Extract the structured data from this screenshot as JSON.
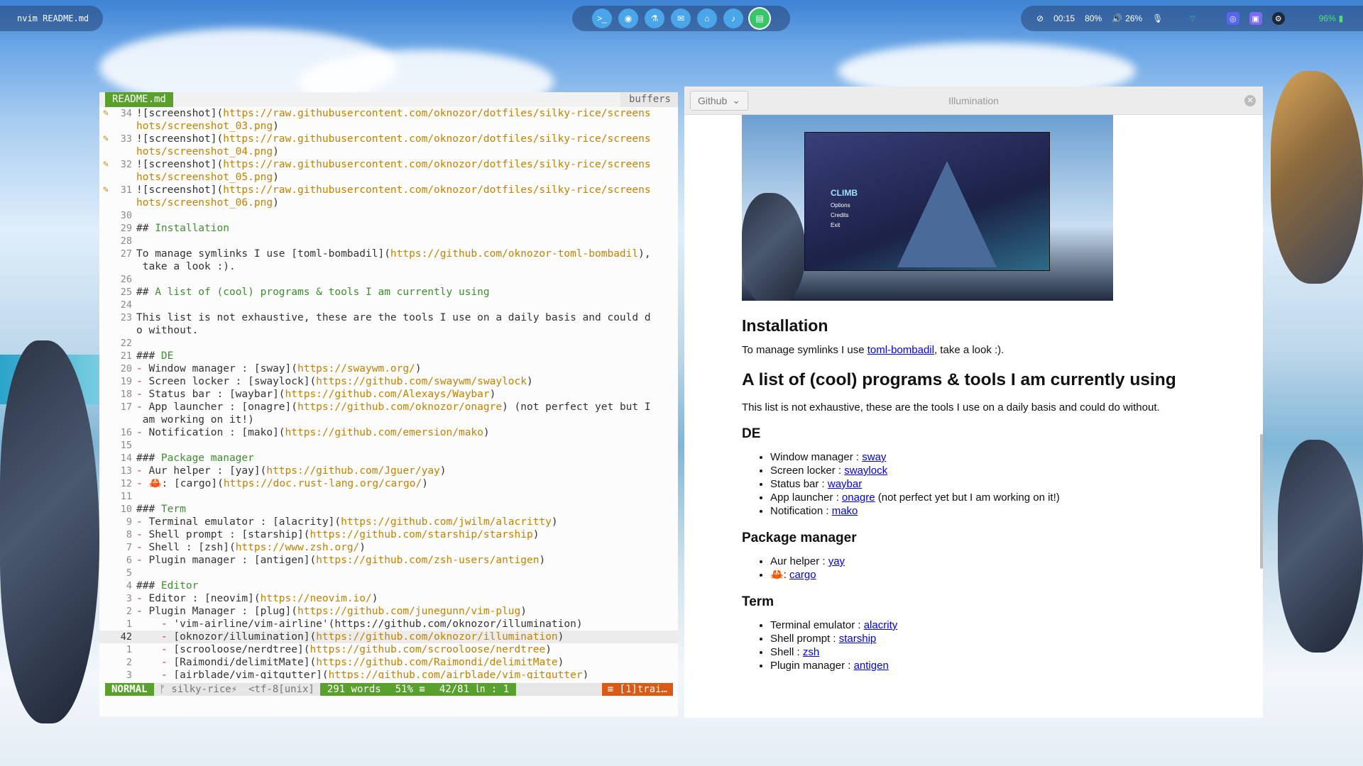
{
  "topbar": {
    "window_title": "nvim README.md",
    "launcher_icons": [
      "terminal-icon",
      "browser-icon",
      "flask-icon",
      "chat-icon",
      "home-icon",
      "music-icon",
      "notes-icon"
    ],
    "status": {
      "time": "00:15",
      "brightness": "80%",
      "volume": "26%",
      "battery": "96%"
    }
  },
  "editor": {
    "tab_active": "README.md",
    "tab_buffers": "buffers",
    "lines": [
      {
        "n": "34",
        "g": "✎",
        "segs": [
          [
            "t",
            "!["
          ],
          [
            "t",
            "screenshot"
          ],
          [
            "t",
            "]("
          ],
          [
            "u",
            "https://raw.githubusercontent.com/oknozor/dotfiles/silky-rice/screens"
          ]
        ]
      },
      {
        "n": "",
        "g": "",
        "segs": [
          [
            "u",
            "hots/screenshot_03.png"
          ],
          [
            "t",
            ")"
          ]
        ]
      },
      {
        "n": "33",
        "g": "✎",
        "segs": [
          [
            "t",
            "![screenshot]("
          ],
          [
            "u",
            "https://raw.githubusercontent.com/oknozor/dotfiles/silky-rice/screens"
          ]
        ]
      },
      {
        "n": "",
        "g": "",
        "segs": [
          [
            "u",
            "hots/screenshot_04.png"
          ],
          [
            "t",
            ")"
          ]
        ]
      },
      {
        "n": "32",
        "g": "✎",
        "segs": [
          [
            "t",
            "![screenshot]("
          ],
          [
            "u",
            "https://raw.githubusercontent.com/oknozor/dotfiles/silky-rice/screens"
          ]
        ]
      },
      {
        "n": "",
        "g": "",
        "segs": [
          [
            "u",
            "hots/screenshot_05.png"
          ],
          [
            "t",
            ")"
          ]
        ]
      },
      {
        "n": "31",
        "g": "✎",
        "segs": [
          [
            "t",
            "![screenshot]("
          ],
          [
            "u",
            "https://raw.githubusercontent.com/oknozor/dotfiles/silky-rice/screens"
          ]
        ]
      },
      {
        "n": "",
        "g": "",
        "segs": [
          [
            "u",
            "hots/screenshot_06.png"
          ],
          [
            "t",
            ")"
          ]
        ]
      },
      {
        "n": "30",
        "g": "",
        "segs": []
      },
      {
        "n": "29",
        "g": "",
        "segs": [
          [
            "t",
            "## "
          ],
          [
            "h",
            "Installation"
          ]
        ]
      },
      {
        "n": "28",
        "g": "",
        "segs": []
      },
      {
        "n": "27",
        "g": "",
        "segs": [
          [
            "t",
            "To manage symlinks I use [toml-bombadil]("
          ],
          [
            "u",
            "https://github.com/oknozor-toml-bombadil"
          ],
          [
            "t",
            "),"
          ]
        ]
      },
      {
        "n": "",
        "g": "",
        "segs": [
          [
            "t",
            " take a look :)."
          ]
        ]
      },
      {
        "n": "26",
        "g": "",
        "segs": []
      },
      {
        "n": "25",
        "g": "",
        "segs": [
          [
            "t",
            "## "
          ],
          [
            "h",
            "A list of (cool) programs & tools I am currently using"
          ]
        ]
      },
      {
        "n": "24",
        "g": "",
        "segs": []
      },
      {
        "n": "23",
        "g": "",
        "segs": [
          [
            "t",
            "This list is not exhaustive, these are the tools I use on a daily basis and could d"
          ]
        ]
      },
      {
        "n": "",
        "g": "",
        "segs": [
          [
            "t",
            "o without."
          ]
        ]
      },
      {
        "n": "22",
        "g": "",
        "segs": []
      },
      {
        "n": "21",
        "g": "",
        "segs": [
          [
            "t",
            "### "
          ],
          [
            "h",
            "DE"
          ]
        ]
      },
      {
        "n": "20",
        "g": "",
        "segs": [
          [
            "b",
            "- "
          ],
          [
            "t",
            "Window manager : [sway]("
          ],
          [
            "u",
            "https://swaywm.org/"
          ],
          [
            "t",
            ")"
          ]
        ]
      },
      {
        "n": "19",
        "g": "",
        "segs": [
          [
            "b",
            "- "
          ],
          [
            "t",
            "Screen locker : [swaylock]("
          ],
          [
            "u",
            "https://github.com/swaywm/swaylock"
          ],
          [
            "t",
            ")"
          ]
        ]
      },
      {
        "n": "18",
        "g": "",
        "segs": [
          [
            "b",
            "- "
          ],
          [
            "t",
            "Status bar : [waybar]("
          ],
          [
            "u",
            "https://github.com/Alexays/Waybar"
          ],
          [
            "t",
            ")"
          ]
        ]
      },
      {
        "n": "17",
        "g": "",
        "segs": [
          [
            "b",
            "- "
          ],
          [
            "t",
            "App launcher : [onagre]("
          ],
          [
            "u",
            "https://github.com/oknozor/onagre"
          ],
          [
            "t",
            ") (not perfect yet but I"
          ]
        ]
      },
      {
        "n": "",
        "g": "",
        "segs": [
          [
            "t",
            " am working on it!)"
          ]
        ]
      },
      {
        "n": "16",
        "g": "",
        "segs": [
          [
            "b",
            "- "
          ],
          [
            "t",
            "Notification : [mako]("
          ],
          [
            "u",
            "https://github.com/emersion/mako"
          ],
          [
            "t",
            ")"
          ]
        ]
      },
      {
        "n": "15",
        "g": "",
        "segs": []
      },
      {
        "n": "14",
        "g": "",
        "segs": [
          [
            "t",
            "### "
          ],
          [
            "h",
            "Package manager"
          ]
        ]
      },
      {
        "n": "13",
        "g": "",
        "segs": [
          [
            "b",
            "- "
          ],
          [
            "t",
            "Aur helper : [yay]("
          ],
          [
            "u",
            "https://github.com/Jguer/yay"
          ],
          [
            "t",
            ")"
          ]
        ]
      },
      {
        "n": "12",
        "g": "",
        "segs": [
          [
            "b",
            "- "
          ],
          [
            "t",
            "🦀: [cargo]("
          ],
          [
            "u",
            "https://doc.rust-lang.org/cargo/"
          ],
          [
            "t",
            ")"
          ]
        ]
      },
      {
        "n": "11",
        "g": "",
        "segs": []
      },
      {
        "n": "10",
        "g": "",
        "segs": [
          [
            "t",
            "### "
          ],
          [
            "h",
            "Term"
          ]
        ]
      },
      {
        "n": "9",
        "g": "",
        "segs": [
          [
            "b",
            "- "
          ],
          [
            "t",
            "Terminal emulator : [alacrity]("
          ],
          [
            "u",
            "https://github.com/jwilm/alacritty"
          ],
          [
            "t",
            ")"
          ]
        ]
      },
      {
        "n": "8",
        "g": "",
        "segs": [
          [
            "b",
            "- "
          ],
          [
            "t",
            "Shell prompt : [starship]("
          ],
          [
            "u",
            "https://github.com/starship/starship"
          ],
          [
            "t",
            ")"
          ]
        ]
      },
      {
        "n": "7",
        "g": "",
        "segs": [
          [
            "b",
            "- "
          ],
          [
            "t",
            "Shell : [zsh]("
          ],
          [
            "u",
            "https://www.zsh.org/"
          ],
          [
            "t",
            ")"
          ]
        ]
      },
      {
        "n": "6",
        "g": "",
        "segs": [
          [
            "b",
            "- "
          ],
          [
            "t",
            "Plugin manager : [antigen]("
          ],
          [
            "u",
            "https://github.com/zsh-users/antigen"
          ],
          [
            "t",
            ")"
          ]
        ]
      },
      {
        "n": "5",
        "g": "",
        "segs": []
      },
      {
        "n": "4",
        "g": "",
        "segs": [
          [
            "t",
            "### "
          ],
          [
            "h",
            "Editor"
          ]
        ]
      },
      {
        "n": "3",
        "g": "",
        "segs": [
          [
            "b",
            "- "
          ],
          [
            "t",
            "Editor : [neovim]("
          ],
          [
            "u",
            "https://neovim.io/"
          ],
          [
            "t",
            ")"
          ]
        ]
      },
      {
        "n": "2",
        "g": "",
        "segs": [
          [
            "b",
            "- "
          ],
          [
            "t",
            "Plugin Manager : [plug]("
          ],
          [
            "u",
            "https://github.com/junegunn/vim-plug"
          ],
          [
            "t",
            ")"
          ]
        ]
      },
      {
        "n": "1",
        "g": "",
        "segs": [
          [
            "t",
            "    "
          ],
          [
            "b",
            "- "
          ],
          [
            "t",
            "'vim-airline/vim-airline'(https://github.com/oknozor/illumination)"
          ]
        ]
      },
      {
        "n": "42",
        "g": "",
        "cur": true,
        "segs": [
          [
            "t",
            "    "
          ],
          [
            "b",
            "- "
          ],
          [
            "t",
            "[oknozor/illumination]("
          ],
          [
            "u",
            "https://github.com/oknozor/illumination"
          ],
          [
            "t",
            ")"
          ]
        ]
      },
      {
        "n": "1",
        "g": "",
        "segs": [
          [
            "t",
            "    "
          ],
          [
            "b",
            "- "
          ],
          [
            "t",
            "[scrooloose/nerdtree]("
          ],
          [
            "u",
            "https://github.com/scrooloose/nerdtree"
          ],
          [
            "t",
            ")"
          ]
        ]
      },
      {
        "n": "2",
        "g": "",
        "segs": [
          [
            "t",
            "    "
          ],
          [
            "b",
            "- "
          ],
          [
            "t",
            "[Raimondi/delimitMate]("
          ],
          [
            "u",
            "https://github.com/Raimondi/delimitMate"
          ],
          [
            "t",
            ")"
          ]
        ]
      },
      {
        "n": "3",
        "g": "",
        "segs": [
          [
            "t",
            "    "
          ],
          [
            "b",
            "- "
          ],
          [
            "t",
            "[airblade/vim-gitgutter]("
          ],
          [
            "u",
            "https://github.com/airblade/vim-gitgutter"
          ],
          [
            "t",
            ")"
          ]
        ]
      }
    ],
    "statusline": {
      "mode": "NORMAL",
      "branch": "ᚠ silky-rice⚡",
      "encoding": "<tf-8[unix]",
      "words": "291 words",
      "percent": "51% ≡",
      "position": "42/81 ㏑ :  1",
      "warning": "≡ [1]trai…"
    }
  },
  "browser": {
    "selector": "Github",
    "title": "Illumination",
    "game": {
      "title": "CLIMB",
      "menu": [
        "Options",
        "Credits",
        "Exit"
      ]
    },
    "h_install": "Installation",
    "p_install_pre": "To manage symlinks I use ",
    "p_install_link": "toml-bombadil",
    "p_install_post": ", take a look :).",
    "h_list": "A list of (cool) programs & tools I am currently using",
    "p_list": "This list is not exhaustive, these are the tools I use on a daily basis and could do without.",
    "h_de": "DE",
    "de": [
      {
        "label": "Window manager : ",
        "link": "sway",
        "post": ""
      },
      {
        "label": "Screen locker : ",
        "link": "swaylock",
        "post": ""
      },
      {
        "label": "Status bar : ",
        "link": "waybar",
        "post": ""
      },
      {
        "label": "App launcher : ",
        "link": "onagre",
        "post": " (not perfect yet but I am working on it!)"
      },
      {
        "label": "Notification : ",
        "link": "mako",
        "post": ""
      }
    ],
    "h_pkg": "Package manager",
    "pkg": [
      {
        "label": "Aur helper : ",
        "link": "yay",
        "post": ""
      },
      {
        "label": "🦀: ",
        "link": "cargo",
        "post": ""
      }
    ],
    "h_term": "Term",
    "term": [
      {
        "label": "Terminal emulator : ",
        "link": "alacrity",
        "post": ""
      },
      {
        "label": "Shell prompt : ",
        "link": "starship",
        "post": ""
      },
      {
        "label": "Shell : ",
        "link": "zsh",
        "post": ""
      },
      {
        "label": "Plugin manager : ",
        "link": "antigen",
        "post": ""
      }
    ]
  }
}
